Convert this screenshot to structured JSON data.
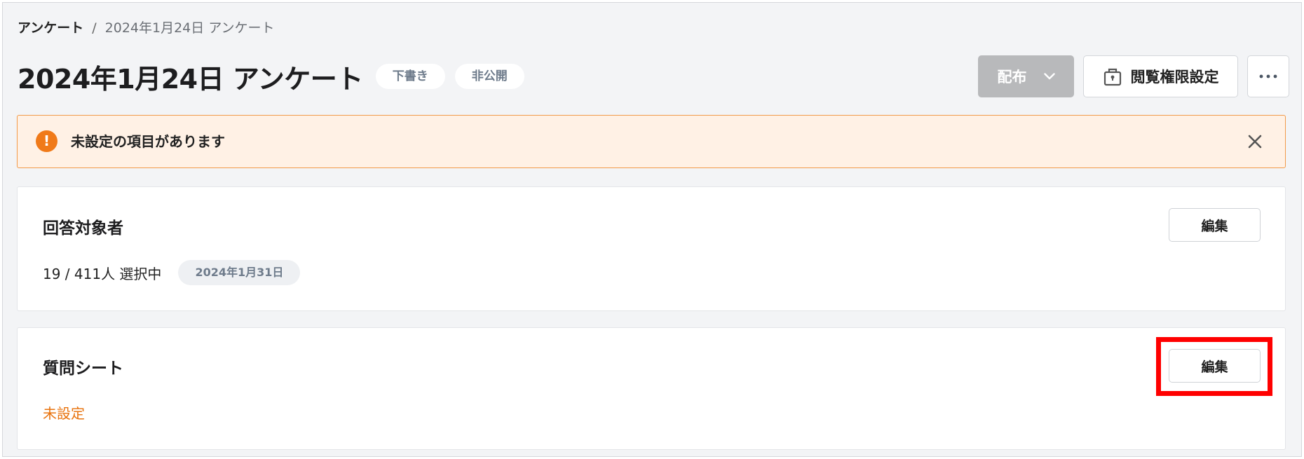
{
  "breadcrumb": {
    "root": "アンケート",
    "separator": "/",
    "current": "2024年1月24日 アンケート"
  },
  "header": {
    "title": "2024年1月24日 アンケート",
    "badges": [
      "下書き",
      "非公開"
    ],
    "distribute_label": "配布",
    "permission_label": "閲覧権限設定",
    "more_icon": "ellipsis-icon"
  },
  "alert": {
    "icon": "exclamation-icon",
    "text": "未設定の項目があります",
    "close_icon": "close-icon",
    "color": "#f07a19"
  },
  "respondents": {
    "title": "回答対象者",
    "edit_label": "編集",
    "selection": "19 / 411人 選択中",
    "date": "2024年1月31日"
  },
  "questions": {
    "title": "質問シート",
    "edit_label": "編集",
    "status": "未設定",
    "status_color": "#e8730e"
  },
  "highlight_color": "#ff0000"
}
